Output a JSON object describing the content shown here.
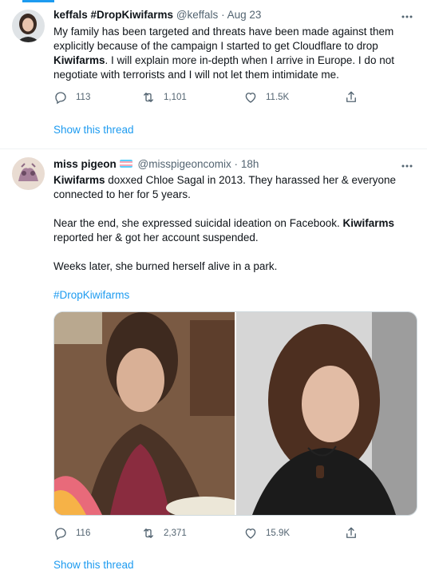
{
  "tweets": [
    {
      "name": "keffals #DropKiwifarms",
      "handle": "@keffals",
      "separator": "·",
      "time": "Aug 23",
      "text_1": "My family has been targeted and threats have been made against them explicitly because of the campaign I started to get Cloudflare to drop ",
      "text_bold_1": "Kiwifarms",
      "text_2": ". I will explain more in-depth when I arrive in Europe. I do not negotiate with terrorists and I will not let them intimidate me.",
      "replies": "113",
      "retweets": "1,101",
      "likes": "11.5K",
      "show_thread": "Show this thread"
    },
    {
      "name": "miss pigeon",
      "handle": "@misspigeoncomix",
      "separator": "·",
      "time": "18h",
      "p1_bold": "Kiwifarms",
      "p1_text": " doxxed Chloe Sagal in 2013. They harassed her & everyone connected to her for 5 years.",
      "p2_text": "Near the end, she expressed suicidal ideation on Facebook. ",
      "p2_bold": "Kiwifarms",
      "p2_text_2": " reported her & got her account suspended.",
      "p3_text": "Weeks later, she burned herself alive in a park.",
      "hashtag": "#DropKiwifarms",
      "replies": "116",
      "retweets": "2,371",
      "likes": "15.9K",
      "show_thread": "Show this thread"
    }
  ],
  "colors": {
    "accent": "#1d9bf0",
    "muted": "#536471",
    "text": "#0f1419",
    "divider": "#eff3f4"
  },
  "icons": [
    "reply-icon",
    "retweet-icon",
    "like-icon",
    "share-icon",
    "more-icon",
    "trans-flag-icon"
  ]
}
